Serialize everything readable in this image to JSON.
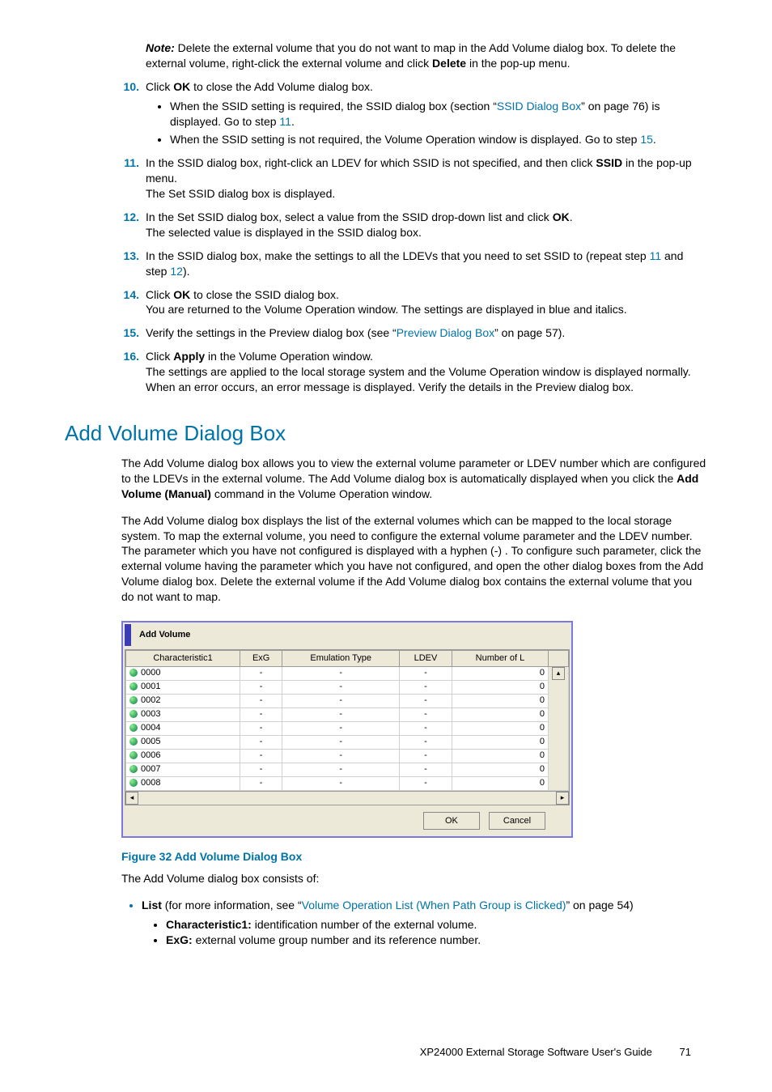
{
  "note": {
    "label": "Note:",
    "text_a": " Delete the external volume that you do not want to map in the Add Volume dialog box. To delete the external volume, right-click the external volume and click ",
    "bold_delete": "Delete",
    "text_b": " in the pop-up menu."
  },
  "steps": {
    "s10": {
      "num": "10.",
      "a": "Click ",
      "b1": "OK",
      "c": " to close the Add Volume dialog box.",
      "sub1_a": "When the SSID setting is required, the SSID dialog box (section “",
      "sub1_link": "SSID Dialog Box",
      "sub1_b": "” on page 76) is displayed. Go to step ",
      "sub1_step": "11",
      "sub1_c": ".",
      "sub2_a": "When the SSID setting is not required, the Volume Operation window is displayed. Go to step ",
      "sub2_step": "15",
      "sub2_b": "."
    },
    "s11": {
      "num": "11.",
      "a": "In the SSID dialog box, right-click an LDEV for which SSID is not specified, and then click ",
      "b1": "SSID",
      "c": " in the pop-up menu.",
      "line2": "The Set SSID dialog box is displayed."
    },
    "s12": {
      "num": "12.",
      "a": "In the Set SSID dialog box, select a value from the SSID drop-down list and click ",
      "b1": "OK",
      "c": ".",
      "line2": "The selected value is displayed in the SSID dialog box."
    },
    "s13": {
      "num": "13.",
      "a": "In the SSID dialog box, make the settings to all the LDEVs that you need to set SSID to (repeat step ",
      "l1": "11",
      "b": " and step ",
      "l2": "12",
      "c": ")."
    },
    "s14": {
      "num": "14.",
      "a": "Click ",
      "b1": "OK",
      "c": " to close the SSID dialog box.",
      "line2": "You are returned to the Volume Operation window. The settings are displayed in blue and italics."
    },
    "s15": {
      "num": "15.",
      "a": "Verify the settings in the Preview dialog box (see “",
      "l1": "Preview Dialog Box",
      "b": "” on page 57)."
    },
    "s16": {
      "num": "16.",
      "a": "Click ",
      "b1": "Apply",
      "c": " in the Volume Operation window.",
      "line2": "The settings are applied to the local storage system and the Volume Operation window is displayed normally. When an error occurs, an error message is displayed. Verify the details in the Preview dialog box."
    }
  },
  "section_title": "Add Volume Dialog Box",
  "para1_a": "The Add Volume dialog box allows you to view the external volume parameter or LDEV number which are configured to the LDEVs in the external volume. The Add Volume dialog box is automatically displayed when you click the ",
  "para1_b": "Add Volume (Manual)",
  "para1_c": " command in the Volume Operation window.",
  "para2": "The Add Volume dialog box displays the list of the external volumes which can be mapped to the local storage system. To map the external volume, you need to configure the external volume parameter and the LDEV number. The parameter which you have not configured is displayed with a hyphen (-) . To configure such parameter, click the external volume having the parameter which you have not configured, and open the other dialog boxes from the Add Volume dialog box. Delete the external volume if the Add Volume dialog box contains the external volume that you do not want to map.",
  "dialog": {
    "title": "Add Volume",
    "headers": [
      "Characteristic1",
      "ExG",
      "Emulation Type",
      "LDEV",
      "Number of L"
    ],
    "rows": [
      {
        "c": "0000",
        "e": "-",
        "t": "-",
        "l": "-",
        "n": "0"
      },
      {
        "c": "0001",
        "e": "-",
        "t": "-",
        "l": "-",
        "n": "0"
      },
      {
        "c": "0002",
        "e": "-",
        "t": "-",
        "l": "-",
        "n": "0"
      },
      {
        "c": "0003",
        "e": "-",
        "t": "-",
        "l": "-",
        "n": "0"
      },
      {
        "c": "0004",
        "e": "-",
        "t": "-",
        "l": "-",
        "n": "0"
      },
      {
        "c": "0005",
        "e": "-",
        "t": "-",
        "l": "-",
        "n": "0"
      },
      {
        "c": "0006",
        "e": "-",
        "t": "-",
        "l": "-",
        "n": "0"
      },
      {
        "c": "0007",
        "e": "-",
        "t": "-",
        "l": "-",
        "n": "0"
      },
      {
        "c": "0008",
        "e": "-",
        "t": "-",
        "l": "-",
        "n": "0"
      }
    ],
    "ok": "OK",
    "cancel": "Cancel"
  },
  "fig_caption": "Figure 32 Add Volume Dialog Box",
  "consists": "The Add Volume dialog box consists of:",
  "list": {
    "a": "List",
    "b": " (for more information, see “",
    "link": "Volume Operation List (When Path Group is Clicked)",
    "c": "” on page 54)",
    "char1_a": "Characteristic1:",
    "char1_b": " identification number of the external volume.",
    "exg_a": "ExG:",
    "exg_b": " external volume group number and its reference number."
  },
  "footer": {
    "text": "XP24000 External Storage Software User's Guide",
    "page": "71"
  }
}
